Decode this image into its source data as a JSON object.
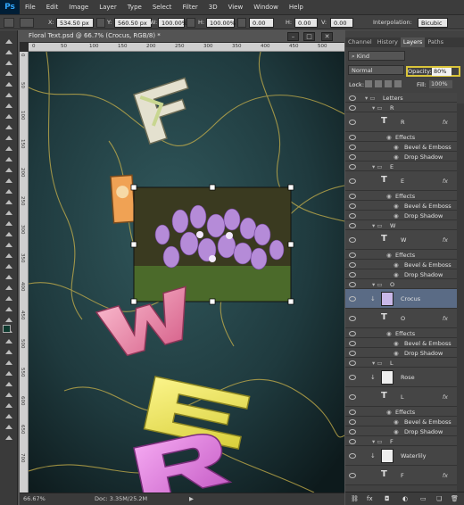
{
  "app": {
    "logo": "Ps"
  },
  "menu": [
    "File",
    "Edit",
    "Image",
    "Layer",
    "Type",
    "Select",
    "Filter",
    "3D",
    "View",
    "Window",
    "Help"
  ],
  "options": {
    "x_label": "X:",
    "x_value": "534.50 px",
    "y_label": "Y:",
    "y_value": "560.50 px",
    "w_label": "W:",
    "w_value": "100.00%",
    "h_label": "H:",
    "h_value": "100.00%",
    "angle_value": "0.00",
    "hskew_label": "H:",
    "hskew_value": "0.00",
    "vskew_label": "V:",
    "vskew_value": "0.00",
    "interp_label": "Interpolation:",
    "interp_value": "Bicubic"
  },
  "document": {
    "title": "Floral Text.psd @ 66.7% (Crocus, RGB/8) *",
    "ruler_ticks": [
      "0",
      "50",
      "100",
      "150",
      "200",
      "250",
      "300",
      "350",
      "400",
      "450",
      "500"
    ],
    "ruler_left_ticks": [
      "0",
      "50",
      "100",
      "150",
      "200",
      "250",
      "300",
      "350",
      "400",
      "450",
      "500",
      "550",
      "600",
      "650",
      "700"
    ],
    "letters": [
      "F",
      "L",
      "W",
      "E",
      "R"
    ],
    "status_zoom": "66.67%",
    "status_doc": "Doc: 3.35M/25.2M"
  },
  "panel": {
    "tabs": [
      "Channel",
      "History",
      "Layers",
      "Paths"
    ],
    "active_tab": "Layers",
    "kind_label": "Kind",
    "blend_mode": "Normal",
    "opacity_label": "Opacity:",
    "opacity_value": "80%",
    "lock_label": "Lock:",
    "fill_label": "Fill:",
    "fill_value": "100%",
    "layers": [
      {
        "type": "group",
        "name": "Letters",
        "indent": 0
      },
      {
        "type": "group",
        "name": "R",
        "indent": 1
      },
      {
        "type": "text",
        "name": "R",
        "fx": true
      },
      {
        "type": "effects",
        "name": "Effects"
      },
      {
        "type": "effect",
        "name": "Bevel & Emboss"
      },
      {
        "type": "effect",
        "name": "Drop Shadow"
      },
      {
        "type": "group",
        "name": "E",
        "indent": 1
      },
      {
        "type": "text",
        "name": "E",
        "fx": true
      },
      {
        "type": "effects",
        "name": "Effects"
      },
      {
        "type": "effect",
        "name": "Bevel & Emboss"
      },
      {
        "type": "effect",
        "name": "Drop Shadow"
      },
      {
        "type": "group",
        "name": "W",
        "indent": 1
      },
      {
        "type": "text",
        "name": "W",
        "fx": true
      },
      {
        "type": "effects",
        "name": "Effects"
      },
      {
        "type": "effect",
        "name": "Bevel & Emboss"
      },
      {
        "type": "effect",
        "name": "Drop Shadow"
      },
      {
        "type": "group",
        "name": "O",
        "indent": 1
      },
      {
        "type": "image",
        "name": "Crocus",
        "selected": true
      },
      {
        "type": "text",
        "name": "O",
        "fx": true
      },
      {
        "type": "effects",
        "name": "Effects"
      },
      {
        "type": "effect",
        "name": "Bevel & Emboss"
      },
      {
        "type": "effect",
        "name": "Drop Shadow"
      },
      {
        "type": "group",
        "name": "L",
        "indent": 1
      },
      {
        "type": "image",
        "name": "Rose"
      },
      {
        "type": "text",
        "name": "L",
        "fx": true
      },
      {
        "type": "effects",
        "name": "Effects"
      },
      {
        "type": "effect",
        "name": "Bevel & Emboss"
      },
      {
        "type": "effect",
        "name": "Drop Shadow"
      },
      {
        "type": "group",
        "name": "F",
        "indent": 1
      },
      {
        "type": "image",
        "name": "Waterlily"
      },
      {
        "type": "text",
        "name": "F",
        "fx": true
      }
    ]
  }
}
